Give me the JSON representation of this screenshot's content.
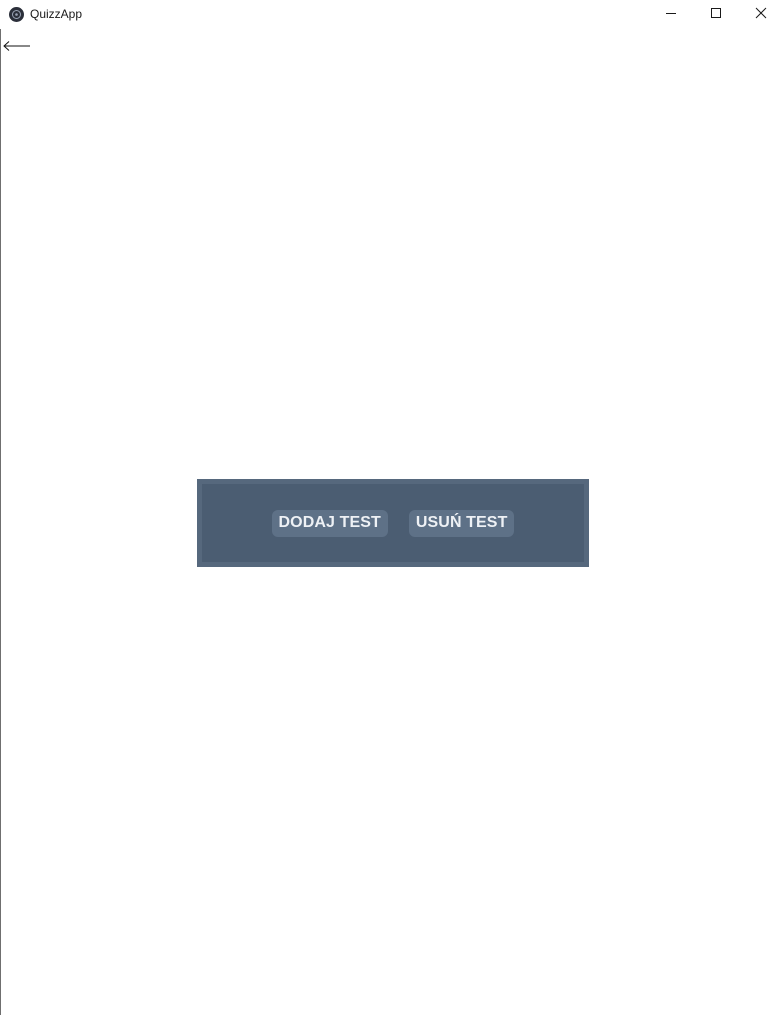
{
  "window": {
    "title": "QuizzApp",
    "icons": {
      "app": "quizzapp-logo-icon",
      "minimize": "minimize-icon",
      "maximize": "maximize-icon",
      "close": "close-icon"
    }
  },
  "navigation": {
    "back_icon": "arrow-left-icon"
  },
  "panel": {
    "add_test_label": "DODAJ TEST",
    "remove_test_label": "USUŃ TEST"
  },
  "colors": {
    "panel_bg": "#4b5d72",
    "panel_border": "#56687d",
    "button_bg": "#5e7187",
    "button_text": "#eef1f5"
  }
}
